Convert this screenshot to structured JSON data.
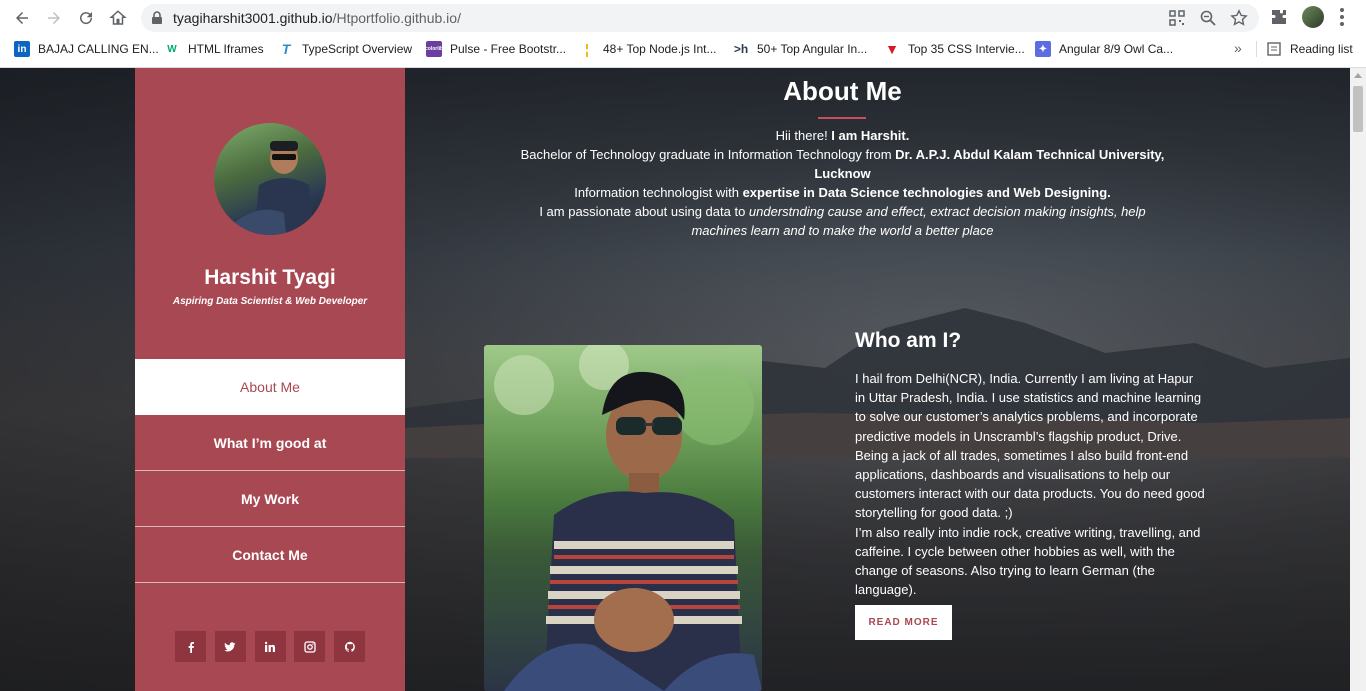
{
  "browser": {
    "url_host": "tyagiharshit3001.github.io",
    "url_path": "/Htportfolio.github.io/",
    "bookmarks": [
      {
        "label": "BAJAJ CALLING EN...",
        "icon": "linkedin-icon",
        "color": "#0a66c2"
      },
      {
        "label": "HTML Iframes",
        "icon": "w3schools-icon",
        "color": "#04aa6d"
      },
      {
        "label": "TypeScript Overview",
        "icon": "tutorialspoint-icon",
        "color": "#2f8dcd"
      },
      {
        "label": "Pulse - Free Bootstr...",
        "icon": "colorlib-icon",
        "color": "#6a3fa0"
      },
      {
        "label": "48+ Top Node.js Int...",
        "icon": "bookmark-icon",
        "color": "#f0b400"
      },
      {
        "label": "50+ Top Angular In...",
        "icon": "hashnode-icon",
        "color": "#2c3e50"
      },
      {
        "label": "Top 35 CSS Intervie...",
        "icon": "triangle-icon",
        "color": "#d81b21"
      },
      {
        "label": "Angular 8/9 Owl Ca...",
        "icon": "bookmark-icon",
        "color": "#5b6ee1"
      }
    ],
    "more": "»",
    "reading_list": "Reading list"
  },
  "sidebar": {
    "name": "Harshit Tyagi",
    "tagline": "Aspiring Data Scientist & Web Developer",
    "menu": [
      {
        "label": "About Me",
        "active": true
      },
      {
        "label": "What I’m good at",
        "active": false
      },
      {
        "label": "My Work",
        "active": false
      },
      {
        "label": "Contact Me",
        "active": false
      }
    ],
    "social": [
      "facebook-icon",
      "twitter-icon",
      "linkedin-icon",
      "instagram-icon",
      "github-icon"
    ]
  },
  "about": {
    "title": "About Me",
    "intro": {
      "l1_a": "Hii there! ",
      "l1_b": "I am Harshit.",
      "l2_a": "Bachelor of Technology graduate in Information Technology from ",
      "l2_b": "Dr. A.P.J. Abdul Kalam Technical University, Lucknow",
      "l3_a": "Information technologist with ",
      "l3_b": "expertise in Data Science technologies and Web Designing.",
      "l4_a": "I am passionate about using data to ",
      "l4_b": "understnding cause and effect, extract decision making insights, help machines learn and to make the world a better place"
    }
  },
  "who": {
    "title": "Who am I?",
    "p1": "I hail from Delhi(NCR), India. Currently I am living at Hapur in Uttar Pradesh, India. I use statistics and machine learning to solve our customer’s analytics problems, and incorporate predictive models in Unscrambl’s flagship product, Drive. Being a jack of all trades, sometimes I also build front-end applications, dashboards and visualisations to help our customers interact with our data products. You do need good storytelling for good data. ;)",
    "p2": "I’m also really into indie rock, creative writing, travelling, and caffeine. I cycle between other hobbies as well, with the change of seasons. Also trying to learn German (the language).",
    "button": "READ MORE"
  },
  "colors": {
    "accent": "#a84853",
    "accent_dark": "#8f3540",
    "title_underline": "#c94f5b"
  }
}
